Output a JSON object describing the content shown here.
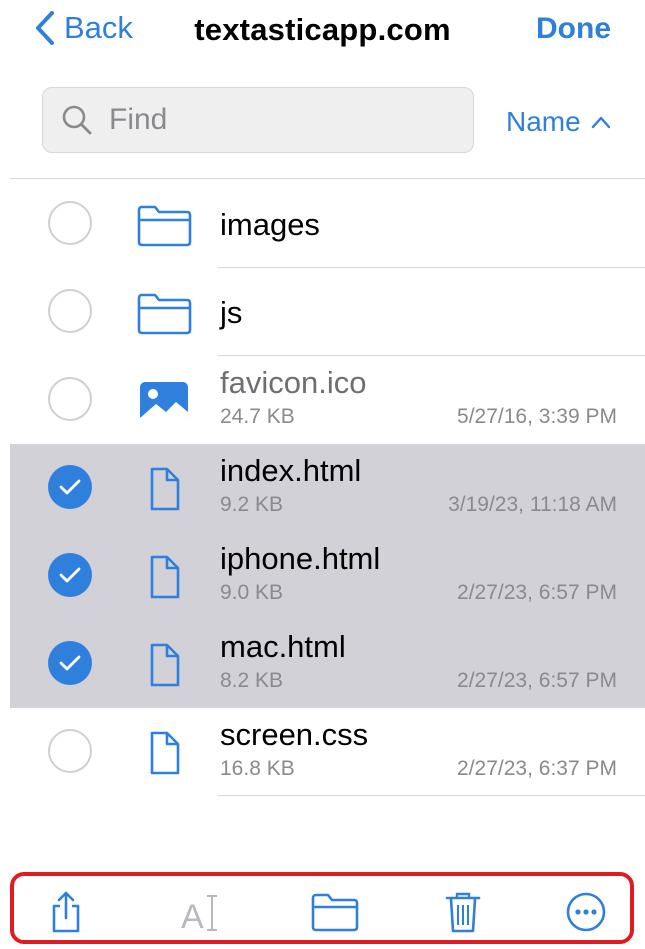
{
  "nav": {
    "back_label": "Back",
    "title": "textasticapp.com",
    "done_label": "Done"
  },
  "search": {
    "placeholder": "Find",
    "value": ""
  },
  "sort": {
    "label": "Name",
    "direction": "ascending"
  },
  "colors": {
    "accent": "#2f7fdc",
    "selected_row": "#d3d1d8",
    "toolbar_highlight": "#e11b22"
  },
  "files": [
    {
      "name": "images",
      "kind": "folder",
      "icon": "folder-icon",
      "selected": false
    },
    {
      "name": "js",
      "kind": "folder",
      "icon": "folder-icon",
      "selected": false
    },
    {
      "name": "favicon.ico",
      "kind": "image",
      "icon": "image-file-icon",
      "size": "24.7 KB",
      "date": "5/27/16, 3:39 PM",
      "selected": false,
      "dimmed": true
    },
    {
      "name": "index.html",
      "kind": "file",
      "icon": "document-icon",
      "size": "9.2 KB",
      "date": "3/19/23, 11:18 AM",
      "selected": true
    },
    {
      "name": "iphone.html",
      "kind": "file",
      "icon": "document-icon",
      "size": "9.0 KB",
      "date": "2/27/23, 6:57 PM",
      "selected": true
    },
    {
      "name": "mac.html",
      "kind": "file",
      "icon": "document-icon",
      "size": "8.2 KB",
      "date": "2/27/23, 6:57 PM",
      "selected": true
    },
    {
      "name": "screen.css",
      "kind": "file",
      "icon": "document-icon",
      "size": "16.8 KB",
      "date": "2/27/23, 6:37 PM",
      "selected": false
    }
  ],
  "toolbar": {
    "items": [
      {
        "icon": "share-icon",
        "enabled": true
      },
      {
        "icon": "rename-icon",
        "enabled": false
      },
      {
        "icon": "move-folder-icon",
        "enabled": true
      },
      {
        "icon": "trash-icon",
        "enabled": true
      },
      {
        "icon": "more-icon",
        "enabled": true
      }
    ]
  }
}
